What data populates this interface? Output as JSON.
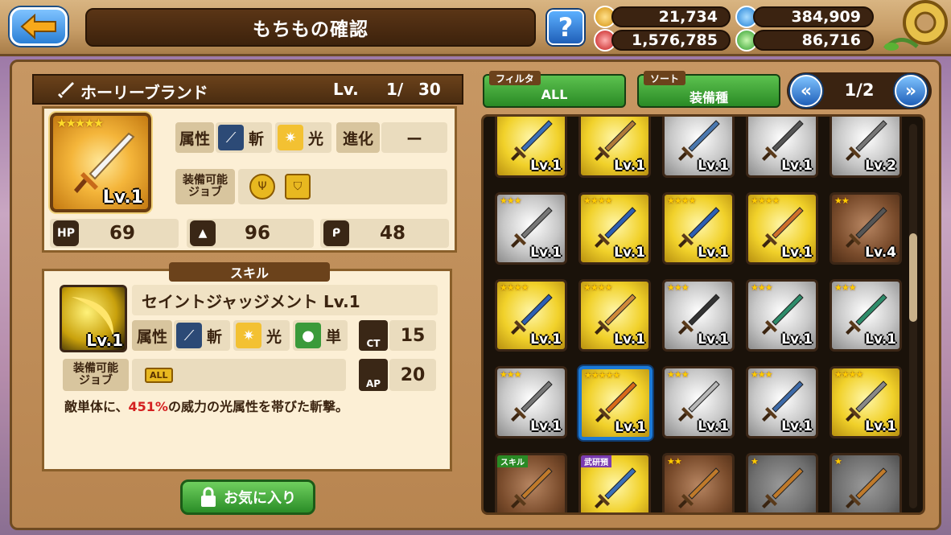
{
  "header": {
    "title": "もちもの確認",
    "help_label": "?",
    "currencies": [
      {
        "icon": "gold-coin-icon",
        "color": "#f0b73a",
        "value": "21,734"
      },
      {
        "icon": "blue-gem-icon",
        "color": "#3aa5ff",
        "value": "384,909"
      },
      {
        "icon": "red-gem-icon",
        "color": "#e63838",
        "value": "1,576,785"
      },
      {
        "icon": "green-gem-icon",
        "color": "#4ec84a",
        "value": "86,716"
      }
    ]
  },
  "item": {
    "name": "ホーリーブランド",
    "lv_label": "Lv.",
    "level": "1/",
    "max_level": "30",
    "stars": "★★★★★",
    "icon_level": "Lv.1",
    "attribute_label": "属性",
    "slash_label": "斬",
    "light_label": "光",
    "evolution_label": "進化",
    "evolution_value": "ー",
    "job_label": "装備可能\nジョブ",
    "stats": [
      {
        "icon": "hp-icon",
        "label": "HP",
        "value": "69"
      },
      {
        "icon": "attack-icon",
        "label": "",
        "value": "96"
      },
      {
        "icon": "magic-icon",
        "label": "",
        "value": "48"
      }
    ]
  },
  "skill": {
    "header": "スキル",
    "name": "セイントジャッジメント Lv.1",
    "icon_level": "Lv.1",
    "attribute_label": "属性",
    "slash_label": "斬",
    "light_label": "光",
    "target_label": "単",
    "ct_label": "CT",
    "ct_value": "15",
    "job_label": "装備可能\nジョブ",
    "job_value": "ALL",
    "ap_label": "AP",
    "ap_value": "20",
    "desc_prefix": "敵単体に、",
    "desc_highlight": "451%",
    "desc_suffix": "の威力の光属性を帯びた斬撃。"
  },
  "favorite_button": "お気に入り",
  "controls": {
    "filter_tab": "フィルタ",
    "filter_value": "ALL",
    "sort_tab": "ソート",
    "sort_value": "装備種",
    "page": "1/2",
    "prev": "«",
    "next": "»"
  },
  "grid": {
    "tiles": [
      {
        "tier": "gold",
        "stars": "",
        "badge": "",
        "lv": "Lv.1",
        "color": "#3a6fb8"
      },
      {
        "tier": "gold",
        "stars": "",
        "badge": "",
        "lv": "Lv.1",
        "color": "#b07a3a"
      },
      {
        "tier": "silver",
        "stars": "",
        "badge": "",
        "lv": "Lv.1",
        "color": "#4a78b0"
      },
      {
        "tier": "silver",
        "stars": "",
        "badge": "",
        "lv": "Lv.1",
        "color": "#555"
      },
      {
        "tier": "silver",
        "stars": "",
        "badge": "",
        "lv": "Lv.2",
        "color": "#777"
      },
      {
        "tier": "silver",
        "stars": "★★★",
        "badge": "",
        "lv": "Lv.1",
        "color": "#777"
      },
      {
        "tier": "gold",
        "stars": "★★★★",
        "badge": "",
        "lv": "Lv.1",
        "color": "#2c5fb4"
      },
      {
        "tier": "gold",
        "stars": "★★★★",
        "badge": "",
        "lv": "Lv.1",
        "color": "#2c5fb4"
      },
      {
        "tier": "gold",
        "stars": "★★★★",
        "badge": "",
        "lv": "Lv.1",
        "color": "#d0702a"
      },
      {
        "tier": "bronze",
        "stars": "★★",
        "badge": "",
        "lv": "Lv.4",
        "color": "#555"
      },
      {
        "tier": "gold",
        "stars": "★★★★",
        "badge": "",
        "lv": "Lv.1",
        "color": "#2c5fb4"
      },
      {
        "tier": "gold",
        "stars": "★★★★",
        "badge": "",
        "lv": "Lv.1",
        "color": "#d08a3a"
      },
      {
        "tier": "silver",
        "stars": "★★★",
        "badge": "",
        "lv": "Lv.1",
        "color": "#333"
      },
      {
        "tier": "silver",
        "stars": "★★★",
        "badge": "",
        "lv": "Lv.1",
        "color": "#2e8c6a"
      },
      {
        "tier": "silver",
        "stars": "★★★",
        "badge": "",
        "lv": "Lv.1",
        "color": "#2e8c6a"
      },
      {
        "tier": "silver",
        "stars": "★★★",
        "badge": "",
        "lv": "Lv.1",
        "color": "#777"
      },
      {
        "tier": "gold",
        "stars": "★★★★★",
        "badge": "",
        "lv": "Lv.1",
        "color": "#d96a1a",
        "selected": true
      },
      {
        "tier": "silver",
        "stars": "★★★",
        "badge": "",
        "lv": "Lv.1",
        "color": "#b8b8b8"
      },
      {
        "tier": "silver",
        "stars": "★★★",
        "badge": "",
        "lv": "Lv.1",
        "color": "#3d6aa8"
      },
      {
        "tier": "gold",
        "stars": "★★★★",
        "badge": "",
        "lv": "Lv.1",
        "color": "#888"
      },
      {
        "tier": "bronze",
        "stars": "",
        "badge": "スキル",
        "badge_color": "#2a8a25",
        "lv": "",
        "color": "#c07a2a"
      },
      {
        "tier": "gold",
        "stars": "",
        "badge": "武研預",
        "badge_color": "#7a3ab0",
        "lv": "",
        "color": "#3a6fb8"
      },
      {
        "tier": "bronze",
        "stars": "★★",
        "badge": "",
        "lv": "",
        "color": "#c07a2a"
      },
      {
        "tier": "dark",
        "stars": "★",
        "badge": "",
        "lv": "",
        "color": "#c07a2a"
      },
      {
        "tier": "dark",
        "stars": "★",
        "badge": "",
        "lv": "",
        "color": "#c07a2a"
      }
    ]
  }
}
